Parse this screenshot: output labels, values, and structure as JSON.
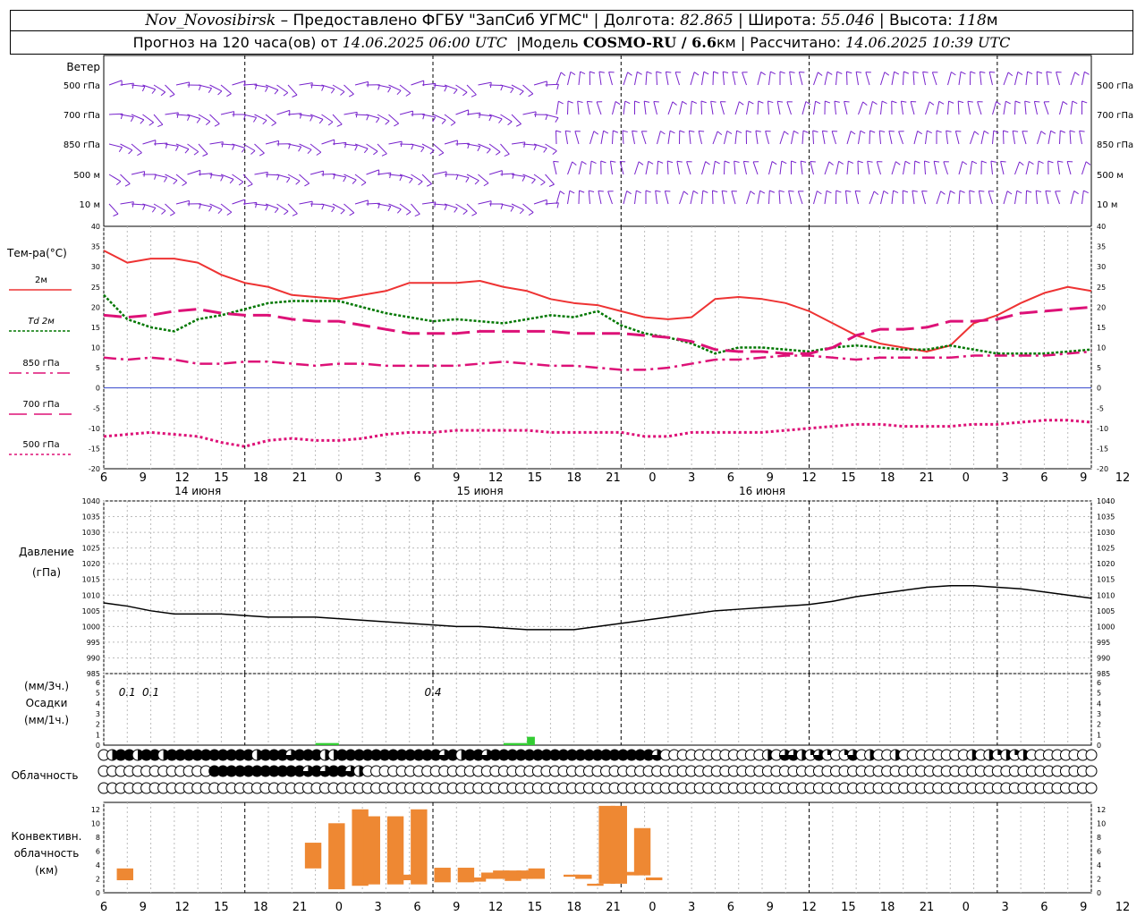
{
  "header": {
    "station": "Nov_Novosibirsk",
    "dash": "–",
    "provided": "Предоставлено ФГБУ \"ЗапСиб УГМС\"",
    "lon_label": "Долгота:",
    "lon": "82.865",
    "lat_label": "Широта:",
    "lat": "55.046",
    "alt_label": "Высота:",
    "alt": "118",
    "alt_unit": "м",
    "sep": "|"
  },
  "subheader": {
    "forecast_prefix": "Прогноз на 120 часа(ов) от",
    "forecast_time": "14.06.2025 06:00 UTC",
    "model_label": "Модель",
    "model": "COSMO-RU / 6.6",
    "model_unit": "км",
    "computed_label": "Рассчитано:",
    "computed": "14.06.2025 10:39 UTC",
    "sep": "|"
  },
  "colors": {
    "t2m": "#ee3333",
    "td2m": "#007700",
    "t850": "#dd1177",
    "t700": "#dd1177",
    "t500": "#dd1177",
    "wind": "#7722cc",
    "pressure": "#000000",
    "precip": "#33cc33",
    "convective": "#ee8833",
    "zero_line": "#3344cc"
  },
  "time_axis": {
    "hours": [
      "6",
      "9",
      "12",
      "15",
      "18",
      "21",
      "0",
      "3",
      "6",
      "9",
      "12",
      "15",
      "18",
      "21",
      "0",
      "3",
      "6",
      "9",
      "12",
      "15",
      "18",
      "21",
      "0",
      "3",
      "6",
      "9",
      "12"
    ],
    "days": [
      "14 июня",
      "15 июня",
      "16 июня"
    ]
  },
  "wind": {
    "title": "Ветер",
    "levels": [
      "500 гПа",
      "700 гПа",
      "850 гПа",
      "500 м",
      "10   м"
    ],
    "icon": "wind-barb-icon"
  },
  "temperature": {
    "title": "Тем-ра(°С)",
    "legend": [
      {
        "label": "2м",
        "style": "solid"
      },
      {
        "label": "Td  2м",
        "style": "dotted"
      },
      {
        "label": "850 гПа",
        "style": "dashdot"
      },
      {
        "label": "700 гПа",
        "style": "longdash"
      },
      {
        "label": "500 гПа",
        "style": "dots"
      }
    ],
    "ticks": [
      "40",
      "35",
      "30",
      "25",
      "20",
      "15",
      "10",
      "5",
      "0",
      "-5",
      "-10",
      "-15",
      "-20"
    ]
  },
  "pressure_panel": {
    "title_1": "Давление",
    "title_2": "(гПа)",
    "ticks": [
      "1040",
      "1035",
      "1030",
      "1025",
      "1020",
      "1015",
      "1010",
      "1005",
      "1000",
      "995",
      "990",
      "985"
    ]
  },
  "precip_panel": {
    "title_1": "(мм/3ч.)",
    "title_2": "Осадки",
    "title_3": "(мм/1ч.)",
    "ticks": [
      "6",
      "5",
      "4",
      "3",
      "2",
      "1",
      "0"
    ],
    "annotations": [
      {
        "hour": 3,
        "text": "0.1"
      },
      {
        "hour": 6,
        "text": "0.1"
      },
      {
        "hour": 42,
        "text": "0.4"
      }
    ]
  },
  "cloud_panel": {
    "title": "Облачность",
    "icon": "cloud-cover-circle-icon"
  },
  "convective_panel": {
    "title_1": "Конвективн.",
    "title_2": "облачность",
    "title_3": "(км)",
    "ticks": [
      "12",
      "10",
      "8",
      "6",
      "4",
      "2",
      "0"
    ]
  },
  "chart_data": {
    "type": "line",
    "title": "Nov_Novosibirsk",
    "x_unit": "hours from 14.06.2025 06:00 UTC",
    "x_range": [
      0,
      126
    ],
    "x_ticks_hours": [
      0,
      3,
      6,
      9,
      12,
      15,
      18,
      21,
      24,
      27,
      30,
      33,
      36,
      39,
      42,
      45,
      48,
      51,
      54,
      57,
      60,
      63,
      66,
      69,
      72,
      75,
      78,
      81,
      84
    ],
    "temperature": {
      "ylabel": "Тем-ра(°С)",
      "ylim": [
        -20,
        40
      ],
      "x": [
        0,
        3,
        6,
        9,
        12,
        15,
        18,
        21,
        24,
        27,
        30,
        33,
        36,
        39,
        42,
        45,
        48,
        51,
        54,
        57,
        60,
        63,
        66,
        69,
        72,
        75,
        78,
        81,
        84,
        87,
        90,
        93,
        96,
        99,
        102,
        105,
        108,
        111,
        114,
        117,
        120,
        123,
        126
      ],
      "series": [
        {
          "name": "2м",
          "values": [
            34,
            31,
            32,
            32,
            31,
            28,
            26,
            25,
            23,
            22.5,
            22,
            23,
            24,
            26,
            26,
            26,
            26.5,
            25,
            24,
            22,
            21,
            20.5,
            19,
            17.5,
            17,
            17.5,
            22,
            22.5,
            22,
            21,
            19,
            16,
            13,
            11,
            10,
            9,
            10.5,
            16,
            18,
            21,
            23.5,
            25,
            24
          ]
        },
        {
          "name": "Td  2м",
          "values": [
            23,
            17,
            15,
            14,
            17,
            18,
            19.5,
            21,
            21.5,
            21.5,
            21.5,
            20,
            18.5,
            17.5,
            16.5,
            17,
            16.5,
            16,
            17,
            18,
            17.5,
            19,
            15.5,
            13.5,
            12.5,
            11,
            8.5,
            10,
            10,
            9.5,
            9,
            10,
            10.5,
            10,
            9.5,
            9.5,
            10.5,
            9.5,
            8.5,
            8.5,
            8.5,
            9,
            9.5
          ]
        },
        {
          "name": "850 гПа",
          "values": [
            7.5,
            7,
            7.5,
            7,
            6,
            6,
            6.5,
            6.5,
            6,
            5.5,
            6,
            6,
            5.5,
            5.5,
            5.5,
            5.5,
            6,
            6.5,
            6,
            5.5,
            5.5,
            5,
            4.5,
            4.5,
            5,
            6,
            7,
            7,
            7.5,
            8,
            8,
            7.5,
            7,
            7.5,
            7.5,
            7.5,
            7.5,
            8,
            8,
            8,
            8,
            8.5,
            9
          ]
        },
        {
          "name": "700 гПа",
          "values": [
            18,
            17.5,
            18,
            19,
            19.5,
            18.5,
            18,
            18,
            17,
            16.5,
            16.5,
            15.5,
            14.5,
            13.5,
            13.5,
            13.5,
            14,
            14,
            14,
            14,
            13.5,
            13.5,
            13.5,
            13,
            12.5,
            11.5,
            9.5,
            9,
            9,
            8.5,
            8.5,
            10,
            13,
            14.5,
            14.5,
            15,
            16.5,
            16.5,
            17,
            18.5,
            19,
            19.5,
            20
          ]
        },
        {
          "name": "500 гПа",
          "values": [
            -12,
            -11.5,
            -11,
            -11.5,
            -12,
            -13.5,
            -14.5,
            -13,
            -12.5,
            -13,
            -13,
            -12.5,
            -11.5,
            -11,
            -11,
            -10.5,
            -10.5,
            -10.5,
            -10.5,
            -11,
            -11,
            -11,
            -11,
            -12,
            -12,
            -11,
            -11,
            -11,
            -11,
            -10.5,
            -10,
            -9.5,
            -9,
            -9,
            -9.5,
            -9.5,
            -9.5,
            -9,
            -9,
            -8.5,
            -8,
            -8,
            -8.5
          ]
        }
      ]
    },
    "pressure": {
      "ylabel": "Давление (гПа)",
      "ylim": [
        985,
        1040
      ],
      "x": [
        0,
        3,
        6,
        9,
        12,
        15,
        18,
        21,
        24,
        27,
        30,
        33,
        36,
        39,
        42,
        45,
        48,
        51,
        54,
        57,
        60,
        63,
        66,
        69,
        72,
        75,
        78,
        81,
        84,
        87,
        90,
        93,
        96,
        99,
        102,
        105,
        108,
        111,
        114,
        117,
        120,
        123,
        126
      ],
      "values": [
        1007.5,
        1006.5,
        1005,
        1004,
        1004,
        1004,
        1003.5,
        1003,
        1003,
        1003,
        1002.5,
        1002,
        1001.5,
        1001,
        1000.5,
        1000,
        1000,
        999.5,
        999,
        999,
        999,
        1000,
        1001,
        1002,
        1003,
        1004,
        1005,
        1005.5,
        1006,
        1006.5,
        1007,
        1008,
        1009.5,
        1010.5,
        1011.5,
        1012.5,
        1013,
        1013,
        1012.5,
        1012,
        1011,
        1010,
        1009
      ]
    },
    "precipitation": {
      "ylabel": "Осадки (мм/3ч.) (мм/1ч.)",
      "ylim": [
        0,
        6
      ],
      "bars": [
        {
          "x0": 27,
          "x1": 30,
          "value": 0.1
        },
        {
          "x0": 51,
          "x1": 54,
          "value": 0.1
        },
        {
          "x0": 54,
          "x1": 55,
          "value": 0.4
        }
      ]
    },
    "convective_cloud": {
      "ylabel": "Конвективн. облачность (км)",
      "ylim": [
        0,
        13
      ],
      "bars": [
        {
          "x": 1,
          "bottom": 1.8,
          "top": 3.5
        },
        {
          "x": 17,
          "bottom": 3.5,
          "top": 7.2
        },
        {
          "x": 19,
          "bottom": 0.5,
          "top": 10
        },
        {
          "x": 21,
          "bottom": 1,
          "top": 12
        },
        {
          "x": 22,
          "bottom": 1.2,
          "top": 11
        },
        {
          "x": 24,
          "bottom": 1.2,
          "top": 11
        },
        {
          "x": 25,
          "bottom": 1.8,
          "top": 2.6
        },
        {
          "x": 26,
          "bottom": 1.2,
          "top": 12
        },
        {
          "x": 28,
          "bottom": 1.5,
          "top": 3.6
        },
        {
          "x": 30,
          "bottom": 1.5,
          "top": 3.6
        },
        {
          "x": 31,
          "bottom": 1.6,
          "top": 2.2
        },
        {
          "x": 32,
          "bottom": 2,
          "top": 2.9
        },
        {
          "x": 33,
          "bottom": 2,
          "top": 3.2
        },
        {
          "x": 34,
          "bottom": 1.7,
          "top": 3.2
        },
        {
          "x": 35,
          "bottom": 2,
          "top": 3.2
        },
        {
          "x": 36,
          "bottom": 2,
          "top": 3.5
        },
        {
          "x": 39,
          "bottom": 2.3,
          "top": 2.6
        },
        {
          "x": 40,
          "bottom": 2,
          "top": 2.6
        },
        {
          "x": 41,
          "bottom": 1,
          "top": 1.3
        },
        {
          "x": 42,
          "bottom": 1.3,
          "top": 12.5
        },
        {
          "x": 43,
          "bottom": 1.3,
          "top": 12.5
        },
        {
          "x": 44,
          "bottom": 2.5,
          "top": 3
        },
        {
          "x": 45,
          "bottom": 2.5,
          "top": 9.3
        },
        {
          "x": 46,
          "bottom": 1.8,
          "top": 2.2
        }
      ]
    },
    "cloudiness": {
      "rows": [
        "upper",
        "middle",
        "lower"
      ],
      "values_oktas": [
        [
          0,
          4,
          8,
          8,
          4,
          8,
          8,
          4,
          8,
          8,
          8,
          8,
          8,
          8,
          8,
          8,
          8,
          8,
          4,
          8,
          8,
          8,
          6,
          8,
          8,
          8,
          4,
          4,
          8,
          8,
          8,
          8,
          8,
          8,
          8,
          8,
          8,
          8,
          8,
          8,
          6,
          8,
          4,
          8,
          8,
          6,
          8,
          8,
          8,
          8,
          8,
          8,
          8,
          8,
          8,
          8,
          8,
          8,
          8,
          8,
          8,
          8,
          8,
          8,
          8,
          6,
          0,
          0,
          0,
          0,
          0,
          0,
          0,
          0,
          0,
          0,
          0,
          0,
          4,
          0,
          6,
          6,
          4,
          2,
          6,
          2,
          0,
          2,
          6,
          0,
          4,
          0,
          0,
          4,
          0,
          0,
          0,
          0,
          0,
          0,
          0,
          0,
          4,
          0,
          4,
          2,
          4,
          2,
          4,
          0,
          0,
          0,
          0,
          0,
          0,
          0,
          0,
          0,
          0,
          0,
          0,
          0
        ],
        [
          0,
          0,
          0,
          0,
          0,
          0,
          0,
          0,
          0,
          0,
          0,
          0,
          0,
          8,
          8,
          8,
          8,
          8,
          8,
          8,
          8,
          8,
          8,
          8,
          6,
          8,
          6,
          8,
          8,
          6,
          4,
          0,
          0,
          0,
          0,
          0,
          0,
          0,
          0,
          0,
          0,
          0,
          0,
          0,
          0,
          0,
          0,
          0,
          0,
          0,
          0,
          0,
          0,
          0,
          0,
          0,
          0,
          0,
          0,
          0,
          0,
          0,
          0,
          0,
          0,
          0,
          0,
          0,
          0,
          0,
          0,
          0,
          0,
          0,
          0,
          0,
          0,
          0,
          0,
          0,
          0,
          0,
          0,
          0,
          0,
          0,
          0,
          0,
          0,
          0,
          0,
          0,
          0,
          0,
          0,
          0,
          0,
          0,
          0,
          0,
          0,
          0,
          0,
          0,
          0,
          0,
          0,
          0,
          0,
          0,
          0,
          0,
          0,
          0,
          0,
          0,
          0,
          0
        ],
        [
          0,
          0,
          0,
          0,
          0,
          0,
          0,
          0,
          0,
          0,
          0,
          0,
          0,
          0,
          0,
          0,
          0,
          0,
          0,
          0,
          0,
          0,
          0,
          0,
          0,
          0,
          0,
          0,
          0,
          0,
          0,
          0,
          0,
          0,
          0,
          0,
          0,
          0,
          0,
          0,
          0,
          0,
          0,
          0,
          0,
          0,
          0,
          0,
          0,
          0,
          0,
          0,
          0,
          0,
          0,
          0,
          0,
          0,
          0,
          0,
          0,
          0,
          0,
          0,
          0,
          0,
          0,
          0,
          0,
          0,
          0,
          0,
          0,
          0,
          0,
          0,
          0,
          0,
          0,
          0,
          0,
          0,
          0,
          0,
          0,
          0,
          0,
          0,
          0,
          0,
          0,
          0,
          0,
          0,
          0,
          0,
          0,
          0,
          0,
          0,
          0,
          0,
          0,
          0,
          0,
          0,
          0,
          0,
          0,
          0,
          0,
          0,
          0,
          0,
          0,
          0,
          0,
          0
        ]
      ]
    }
  }
}
